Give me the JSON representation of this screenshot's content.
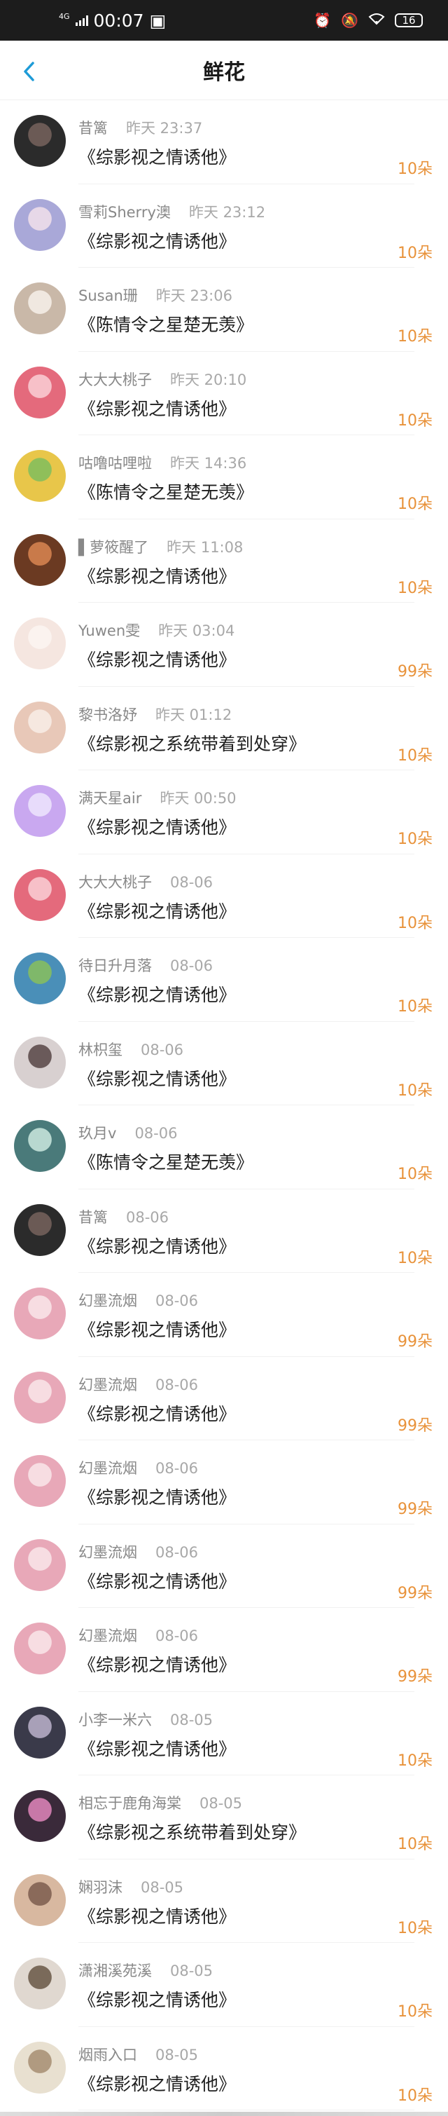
{
  "status_bar": {
    "network": "4G",
    "time": "00:07",
    "battery": "16"
  },
  "header": {
    "title": "鲜花"
  },
  "items": [
    {
      "user": "昔篱",
      "time": "昨天 23:37",
      "book": "《综影视之情诱他》",
      "amount": "10朵"
    },
    {
      "user": "雪莉Sherry澳",
      "time": "昨天 23:12",
      "book": "《综影视之情诱他》",
      "amount": "10朵"
    },
    {
      "user": "Susan珊",
      "time": "昨天 23:06",
      "book": "《陈情令之星楚无羡》",
      "amount": "10朵"
    },
    {
      "user": "大大大桃子",
      "time": "昨天 20:10",
      "book": "《综影视之情诱他》",
      "amount": "10朵"
    },
    {
      "user": "咕噜咕哩啦",
      "time": "昨天 14:36",
      "book": "《陈情令之星楚无羡》",
      "amount": "10朵"
    },
    {
      "user": "▌萝筱醒了",
      "time": "昨天 11:08",
      "book": "《综影视之情诱他》",
      "amount": "10朵"
    },
    {
      "user": "Yuwen雯",
      "time": "昨天 03:04",
      "book": "《综影视之情诱他》",
      "amount": "99朵"
    },
    {
      "user": "黎书洛妤",
      "time": "昨天 01:12",
      "book": "《综影视之系统带着到处穿》",
      "amount": "10朵"
    },
    {
      "user": "满天星air",
      "time": "昨天 00:50",
      "book": "《综影视之情诱他》",
      "amount": "10朵"
    },
    {
      "user": "大大大桃子",
      "time": "08-06",
      "book": "《综影视之情诱他》",
      "amount": "10朵"
    },
    {
      "user": "待日升月落",
      "time": "08-06",
      "book": "《综影视之情诱他》",
      "amount": "10朵"
    },
    {
      "user": "林枳玺",
      "time": "08-06",
      "book": "《综影视之情诱他》",
      "amount": "10朵"
    },
    {
      "user": "玖月v",
      "time": "08-06",
      "book": "《陈情令之星楚无羡》",
      "amount": "10朵"
    },
    {
      "user": "昔篱",
      "time": "08-06",
      "book": "《综影视之情诱他》",
      "amount": "10朵"
    },
    {
      "user": "幻墨流烟",
      "time": "08-06",
      "book": "《综影视之情诱他》",
      "amount": "99朵"
    },
    {
      "user": "幻墨流烟",
      "time": "08-06",
      "book": "《综影视之情诱他》",
      "amount": "99朵"
    },
    {
      "user": "幻墨流烟",
      "time": "08-06",
      "book": "《综影视之情诱他》",
      "amount": "99朵"
    },
    {
      "user": "幻墨流烟",
      "time": "08-06",
      "book": "《综影视之情诱他》",
      "amount": "99朵"
    },
    {
      "user": "幻墨流烟",
      "time": "08-06",
      "book": "《综影视之情诱他》",
      "amount": "99朵"
    },
    {
      "user": "小李一米六",
      "time": "08-05",
      "book": "《综影视之情诱他》",
      "amount": "10朵"
    },
    {
      "user": "相忘于鹿角海棠",
      "time": "08-05",
      "book": "《综影视之系统带着到处穿》",
      "amount": "10朵"
    },
    {
      "user": "娴羽沫",
      "time": "08-05",
      "book": "《综影视之情诱他》",
      "amount": "10朵"
    },
    {
      "user": "潇湘溪苑溪",
      "time": "08-05",
      "book": "《综影视之情诱他》",
      "amount": "10朵"
    },
    {
      "user": "烟雨入口",
      "time": "08-05",
      "book": "《综影视之情诱他》",
      "amount": "10朵"
    }
  ],
  "colors": {
    "accent": "#1e9bd7",
    "amount": "#e8923a",
    "status_bar_bg": "#1c1c1c"
  }
}
